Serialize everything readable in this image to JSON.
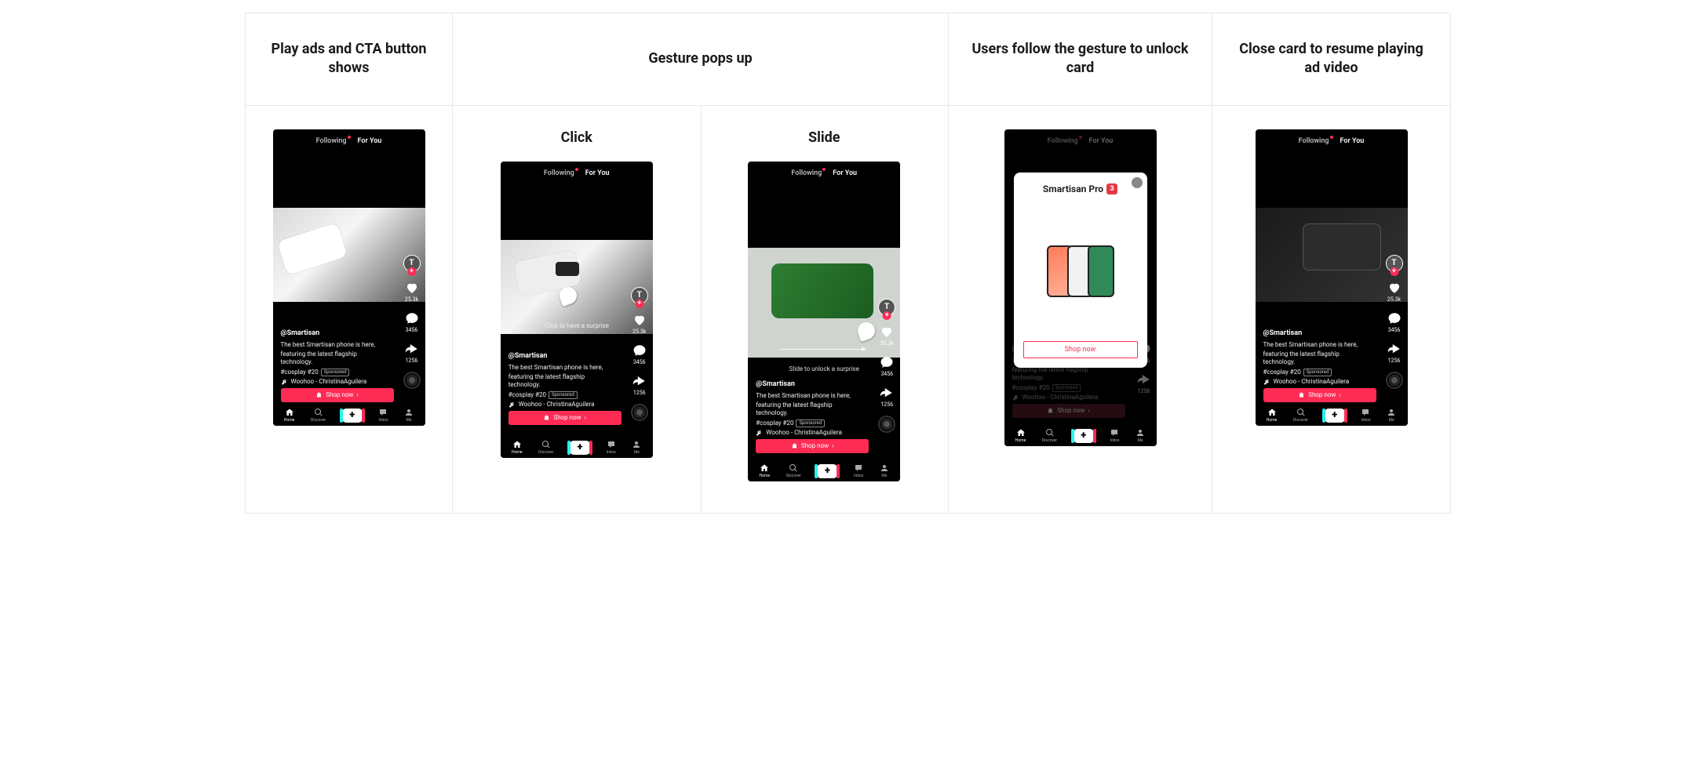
{
  "headers": {
    "col1": "Play ads and CTA button shows",
    "col2": "Gesture pops up",
    "col3": "Users follow the gesture to unlock card",
    "col4": "Close card to resume playing ad video"
  },
  "sublabels": {
    "click": "Click",
    "slide": "Slide"
  },
  "feed_tabs": {
    "following": "Following",
    "for_you": "For You"
  },
  "gesture_text": {
    "click": "Click to have a surprise",
    "slide": "Slide to unlock a surprise"
  },
  "caption": {
    "username": "@Smartisan",
    "text_line1": "The best Smartisan phone is here,",
    "text_line2": "featuring the latest flagship technology.",
    "hashtag": "#cosplay #20",
    "sponsored": "Sponsored",
    "music": "Woohoo - ChristinaAguilera"
  },
  "rail": {
    "avatar_letter": "T",
    "likes": "25.3k",
    "comments": "3456",
    "shares": "1256"
  },
  "cta": {
    "label": "Shop now"
  },
  "card": {
    "title": "Smartisan Pro",
    "badge": "3",
    "cta": "Shop now"
  },
  "nav": {
    "home": "Home",
    "discover": "Discover",
    "inbox": "Inbox",
    "me": "Me"
  }
}
